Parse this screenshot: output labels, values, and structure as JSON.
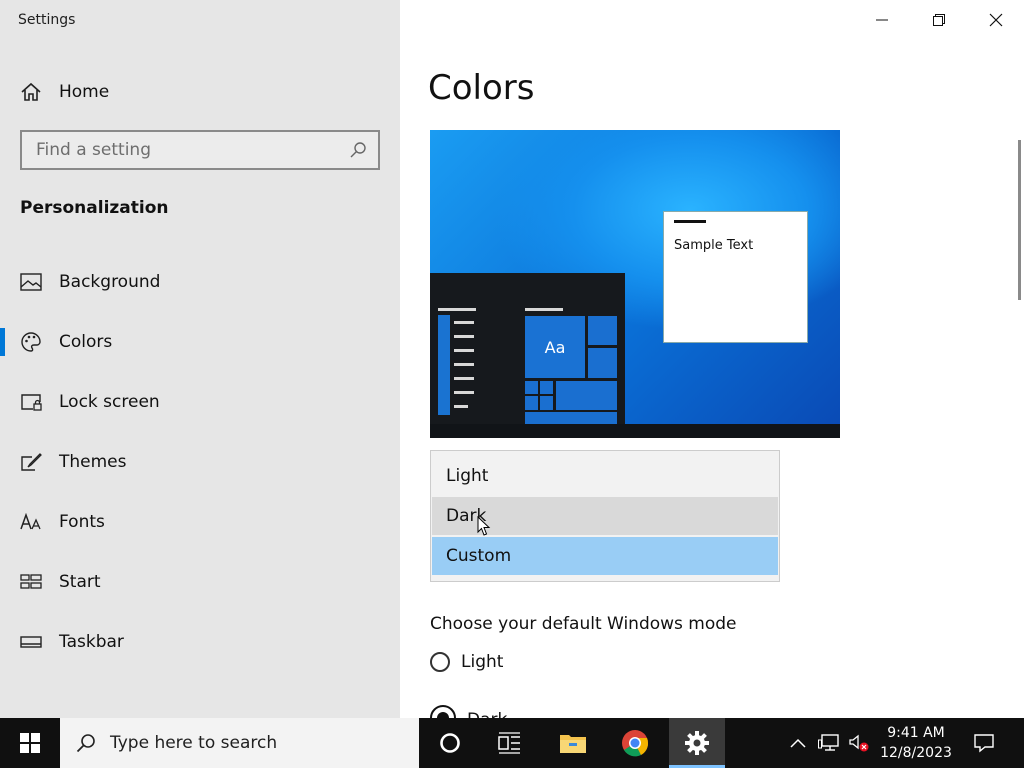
{
  "window": {
    "title": "Settings"
  },
  "sidebar": {
    "home_label": "Home",
    "search_placeholder": "Find a setting",
    "section_heading": "Personalization",
    "items": [
      {
        "label": "Background",
        "icon": "picture-icon",
        "active": false
      },
      {
        "label": "Colors",
        "icon": "palette-icon",
        "active": true
      },
      {
        "label": "Lock screen",
        "icon": "lock-screen-icon",
        "active": false
      },
      {
        "label": "Themes",
        "icon": "themes-brush-icon",
        "active": false
      },
      {
        "label": "Fonts",
        "icon": "fonts-icon",
        "active": false
      },
      {
        "label": "Start",
        "icon": "start-grid-icon",
        "active": false
      },
      {
        "label": "Taskbar",
        "icon": "taskbar-icon",
        "active": false
      }
    ]
  },
  "main": {
    "page_title": "Colors",
    "preview": {
      "tile_label": "Aa",
      "sample_text": "Sample Text"
    },
    "dropdown": {
      "options": [
        "Light",
        "Dark",
        "Custom"
      ],
      "hovered": "Dark",
      "selected": "Custom"
    },
    "default_mode": {
      "heading": "Choose your default Windows mode",
      "options": [
        "Light",
        "Dark"
      ]
    }
  },
  "taskbar": {
    "search_placeholder": "Type here to search",
    "time": "9:41 AM",
    "date": "12/8/2023"
  },
  "colors": {
    "accent": "#0078d7",
    "sidebar_bg": "#e6e6e6",
    "dropdown_selected": "#99cdf5",
    "taskbar_bg": "#101010"
  }
}
